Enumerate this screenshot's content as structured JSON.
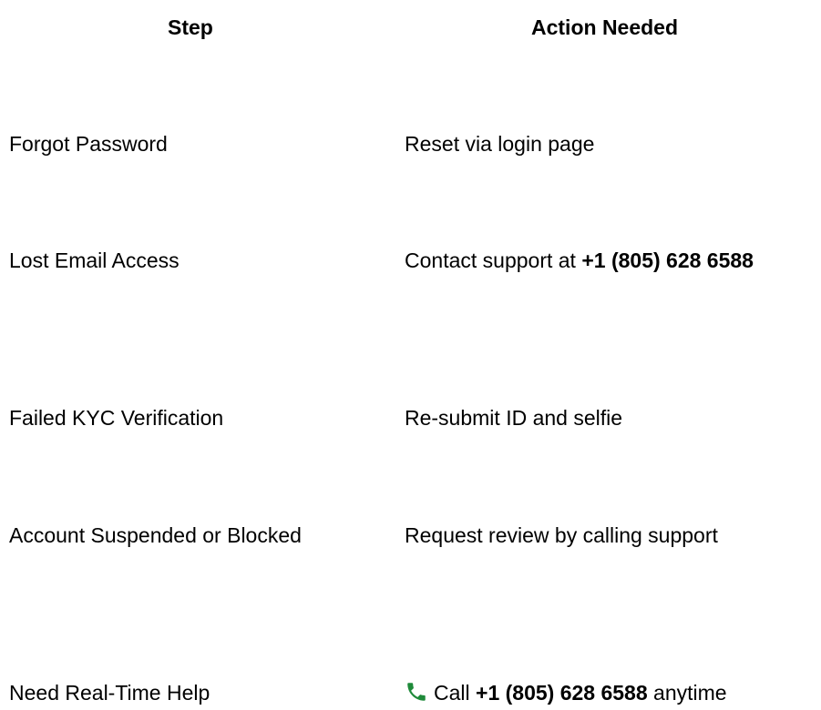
{
  "headers": {
    "step": "Step",
    "action": "Action Needed"
  },
  "rows": [
    {
      "step": "Forgot Password",
      "action_text": "Reset via login page"
    },
    {
      "step": "Lost Email Access",
      "action_prefix": "Contact support at ",
      "action_phone": "+1 (805) 628 6588"
    },
    {
      "step": "Failed KYC Verification",
      "action_text": "Re-submit ID and selfie"
    },
    {
      "step": "Account Suspended or Blocked",
      "action_text": "Request review by calling support"
    },
    {
      "step": "Need Real-Time Help",
      "action_icon": "phone-icon",
      "action_prefix": "Call ",
      "action_phone": "+1 (805) 628 6588",
      "action_suffix": " anytime"
    }
  ],
  "colors": {
    "text": "#000000",
    "background": "#ffffff",
    "phone_icon": "#1f8a3a"
  }
}
